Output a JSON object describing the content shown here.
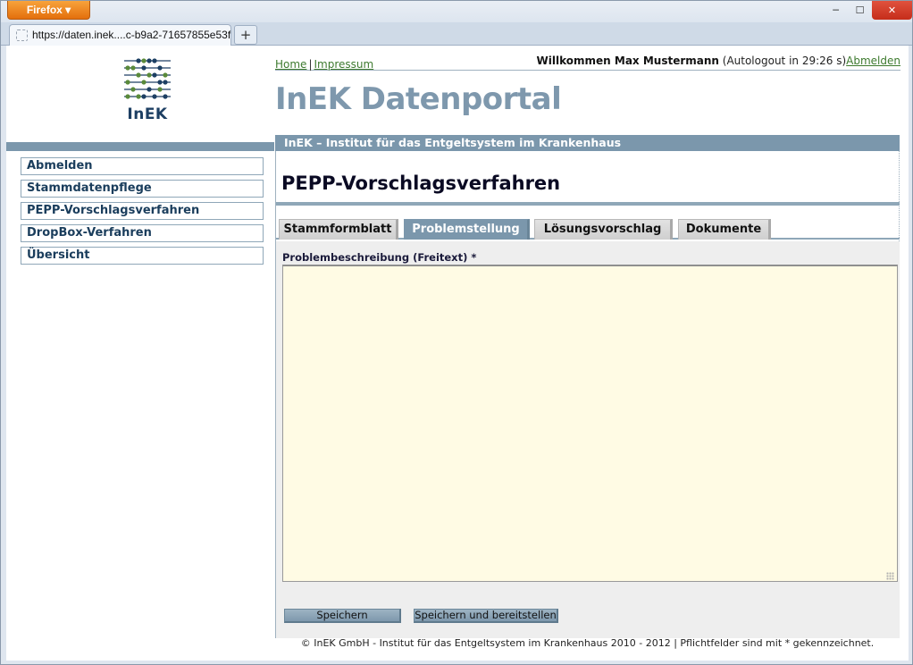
{
  "browser": {
    "menu_label": "Firefox ▾",
    "tab_title": "https://daten.inek....c-b9a2-71657855e53f",
    "newtab_label": "+",
    "minimize": "─",
    "maximize": "☐",
    "close": "✕"
  },
  "header": {
    "logo_text": "InEK",
    "home_link": "Home",
    "link_separator": "|",
    "impressum_link": "Impressum",
    "welcome_name": "Willkommen Max Mustermann",
    "autologout_text": " (Autologout in   29:26 s)",
    "logout_link": "Abmelden",
    "portal_title": "InEK Datenportal",
    "institute_band": "InEK – Institut für das Entgeltsystem im Krankenhaus"
  },
  "sidebar": {
    "items": [
      {
        "label": "Abmelden"
      },
      {
        "label": "Stammdatenpflege"
      },
      {
        "label": "PEPP-Vorschlagsverfahren"
      },
      {
        "label": "DropBox-Verfahren"
      },
      {
        "label": "Übersicht"
      }
    ]
  },
  "main": {
    "heading": "PEPP-Vorschlagsverfahren",
    "tabs": [
      {
        "label": "Stammformblatt",
        "active": false
      },
      {
        "label": "Problemstellung",
        "active": true
      },
      {
        "label": "Lösungsvorschlag",
        "active": false
      },
      {
        "label": "Dokumente",
        "active": false
      }
    ],
    "field_label": "Problembeschreibung (Freitext) *",
    "field_value": "",
    "save_button": "Speichern",
    "save_publish_button": "Speichern und bereitstellen"
  },
  "footer": {
    "text": "© InEK GmbH - Institut für das Entgeltsystem im Krankenhaus 2010 - 2012 | Pflichtfelder sind mit * gekennzeichnet."
  },
  "colors": {
    "accent": "#7b97ac",
    "link": "#3d7a2e",
    "textarea_bg": "#fffbe4",
    "logo_navy": "#1d3f63",
    "logo_green": "#5a8a3a"
  }
}
